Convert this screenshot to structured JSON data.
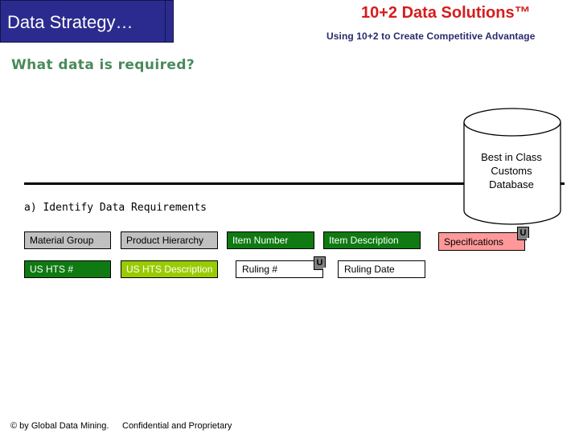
{
  "header": {
    "title": "Data Strategy…",
    "brand": "10+2 Data Solutions™",
    "tagline": "Using 10+2 to Create Competitive Advantage"
  },
  "question": "What data is required?",
  "database": {
    "lines": [
      "Best in Class",
      "Customs",
      "Database"
    ]
  },
  "section_heading": "a) Identify Data Requirements",
  "fields": {
    "row1": [
      {
        "label": "Material Group",
        "color": "#c0c0c0"
      },
      {
        "label": "Product Hierarchy",
        "color": "#c0c0c0"
      },
      {
        "label": "Item Number",
        "color": "#0f7a12"
      },
      {
        "label": "Item Description",
        "color": "#0f7a12"
      },
      {
        "label": "Specifications",
        "color": "#ff9999"
      }
    ],
    "row2": [
      {
        "label": "US HTS #",
        "color": "#0f7a12"
      },
      {
        "label": "US HTS Description",
        "color": "#99cc00"
      },
      {
        "label": "Ruling #",
        "color": "#ffffff"
      },
      {
        "label": "Ruling Date",
        "color": "#ffffff"
      }
    ]
  },
  "badges": {
    "ruling": "U",
    "specifications": "U"
  },
  "footer": {
    "copyright": "© by Global Data Mining.",
    "confidential": "Confidential and Proprietary"
  }
}
